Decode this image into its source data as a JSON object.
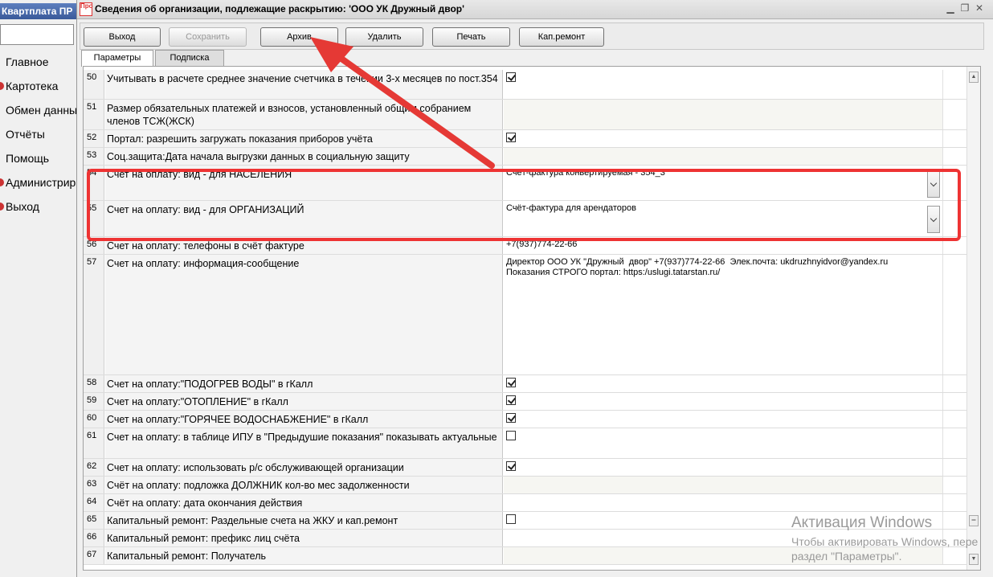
{
  "app": {
    "title": "Квартплата ПР",
    "menu": [
      {
        "label": "Главное"
      },
      {
        "label": "Картотека"
      },
      {
        "label": "Обмен данны"
      },
      {
        "label": "Отчёты"
      },
      {
        "label": "Помощь"
      },
      {
        "label": "Администрир"
      },
      {
        "label": "Выход"
      }
    ]
  },
  "dialog": {
    "logo_text": "Про",
    "title": "Сведения об организации, подлежащие раскрытию: 'ООО УК Дружный двор'",
    "toolbar": {
      "exit": "Выход",
      "save": "Сохранить",
      "archive": "Архив",
      "delete": "Удалить",
      "print": "Печать",
      "kaprem": "Кап.ремонт"
    },
    "tabs": {
      "params": "Параметры",
      "signature": "Подпиcка"
    },
    "rows": [
      {
        "num": "50",
        "label": "Учитывать в расчете среднее значение счетчика в течении 3-х месяцев по пост.354",
        "type": "check",
        "checked": true
      },
      {
        "num": "51",
        "label": "Размер обязательных платежей и взносов, установленный общим собранием членов ТСЖ(ЖСК)",
        "type": "empty"
      },
      {
        "num": "52",
        "label": "Портал: разрешить загружать показания приборов учёта",
        "type": "check",
        "checked": true
      },
      {
        "num": "53",
        "label": "Соц.защита:Дата начала выгрузки данных в социальную защиту",
        "type": "empty"
      },
      {
        "num": "54",
        "label": "Счет на оплату: вид - для НАСЕЛЕНИЯ",
        "type": "dropdown",
        "value": "Счёт-фактура конвертируемая - 354_3"
      },
      {
        "num": "55",
        "label": "Счет на оплату: вид - для ОРГАНИЗАЦИЙ",
        "type": "dropdown",
        "value": "Счёт-фактура для арендаторов"
      },
      {
        "num": "56",
        "label": "Счет на оплату: телефоны в счёт фактуре",
        "type": "text",
        "value": "+7(937)774-22-66"
      },
      {
        "num": "57",
        "label": "Счет на оплату: информация-сообщение",
        "type": "multiline",
        "value": "Директор ООО УК \"Дружный  двор\" +7(937)774-22-66  Элек.почта: ukdruzhnyidvor@yandex.ru\nПоказания СТРОГО портал: https:/uslugi.tatarstan.ru/"
      },
      {
        "num": "58",
        "label": "Счет на оплату:\"ПОДОГРЕВ ВОДЫ\" в гКалл",
        "type": "check",
        "checked": true
      },
      {
        "num": "59",
        "label": "Счет на оплату:\"ОТОПЛЕНИЕ\" в гКалл",
        "type": "check",
        "checked": true
      },
      {
        "num": "60",
        "label": "Счет на оплату:\"ГОРЯЧЕЕ ВОДОСНАБЖЕНИЕ\" в гКалл",
        "type": "check",
        "checked": true
      },
      {
        "num": "61",
        "label": "Счет на оплату: в таблице ИПУ в \"Предыдушие показания\" показывать актуальные",
        "type": "check",
        "checked": false
      },
      {
        "num": "62",
        "label": "Счет на оплату: использовать р/с обслуживающей организации",
        "type": "check",
        "checked": true
      },
      {
        "num": "63",
        "label": "Счёт на оплату: подложка ДОЛЖНИК кол-во мес задолженности",
        "type": "empty"
      },
      {
        "num": "64",
        "label": "Счёт на оплату: дата окончания действия",
        "type": "text",
        "value": ""
      },
      {
        "num": "65",
        "label": "Капитальный ремонт: Раздельные счета на ЖКУ и кап.ремонт",
        "type": "check",
        "checked": false
      },
      {
        "num": "66",
        "label": "Капитальный ремонт: префикс лиц счёта",
        "type": "text",
        "value": ""
      },
      {
        "num": "67",
        "label": "Капитальный ремонт: Получатель",
        "type": "empty"
      }
    ]
  },
  "watermark": {
    "line1": "Активация Windows",
    "line2": "Чтобы активировать Windows, пере",
    "line3": "раздел \"Параметры\"."
  },
  "colors": {
    "annotation": "#e53935"
  }
}
